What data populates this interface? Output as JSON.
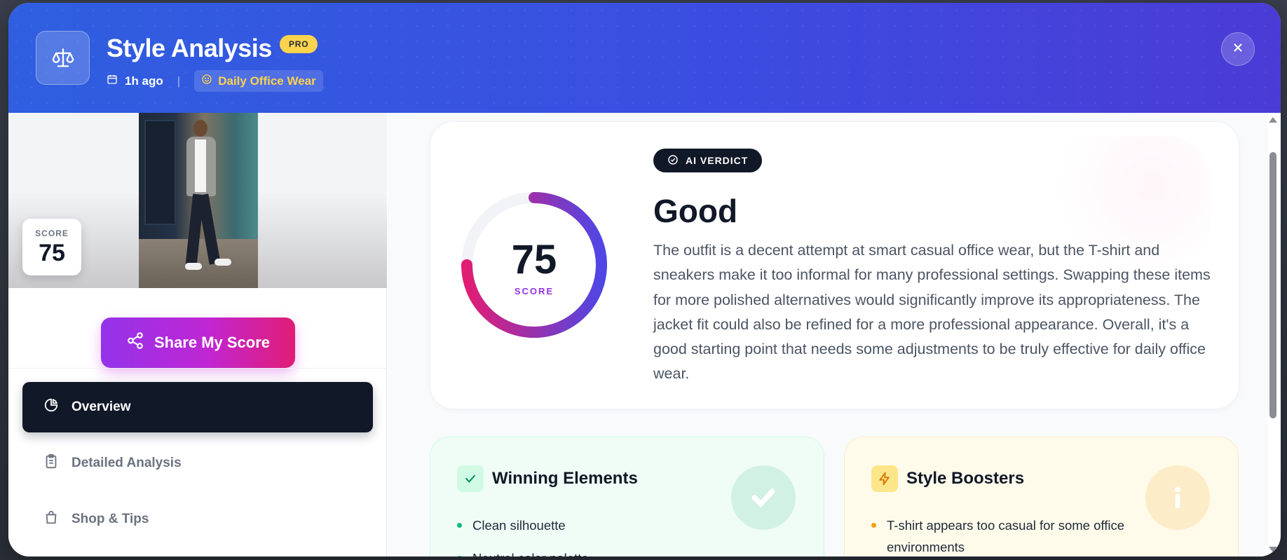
{
  "header": {
    "title": "Style Analysis",
    "badge": "PRO",
    "time": "1h ago",
    "separator": "|",
    "occasion": "Daily Office Wear"
  },
  "left": {
    "score_label": "SCORE",
    "score_value": "75",
    "share_label": "Share My Score",
    "nav": [
      {
        "label": "Overview",
        "active": true,
        "icon": "pie-chart-icon"
      },
      {
        "label": "Detailed Analysis",
        "active": false,
        "icon": "clipboard-icon"
      },
      {
        "label": "Shop & Tips",
        "active": false,
        "icon": "shopping-bag-icon"
      }
    ]
  },
  "verdict": {
    "pill": "AI VERDICT",
    "score": "75",
    "score_label": "SCORE",
    "score_fraction": 0.75,
    "title": "Good",
    "text": "The outfit is a decent attempt at smart casual office wear, but the T-shirt and sneakers make it too informal for many professional settings. Swapping these items for more polished alternatives would significantly improve its appropriateness. The jacket fit could also be refined for a more professional appearance. Overall, it's a good starting point that needs some adjustments to be truly effective for daily office wear."
  },
  "winning": {
    "title": "Winning Elements",
    "items": [
      "Clean silhouette",
      "Neutral color palette"
    ]
  },
  "boosters": {
    "title": "Style Boosters",
    "items": [
      "T-shirt appears too casual for some office environments"
    ]
  },
  "colors": {
    "header_start": "#2f5fe0",
    "header_end": "#4b3bd6",
    "accent_pink": "#e11d74",
    "accent_purple": "#9333ea",
    "pro_badge": "#fcd34d",
    "success": "#10b981",
    "warning": "#f59e0b"
  }
}
